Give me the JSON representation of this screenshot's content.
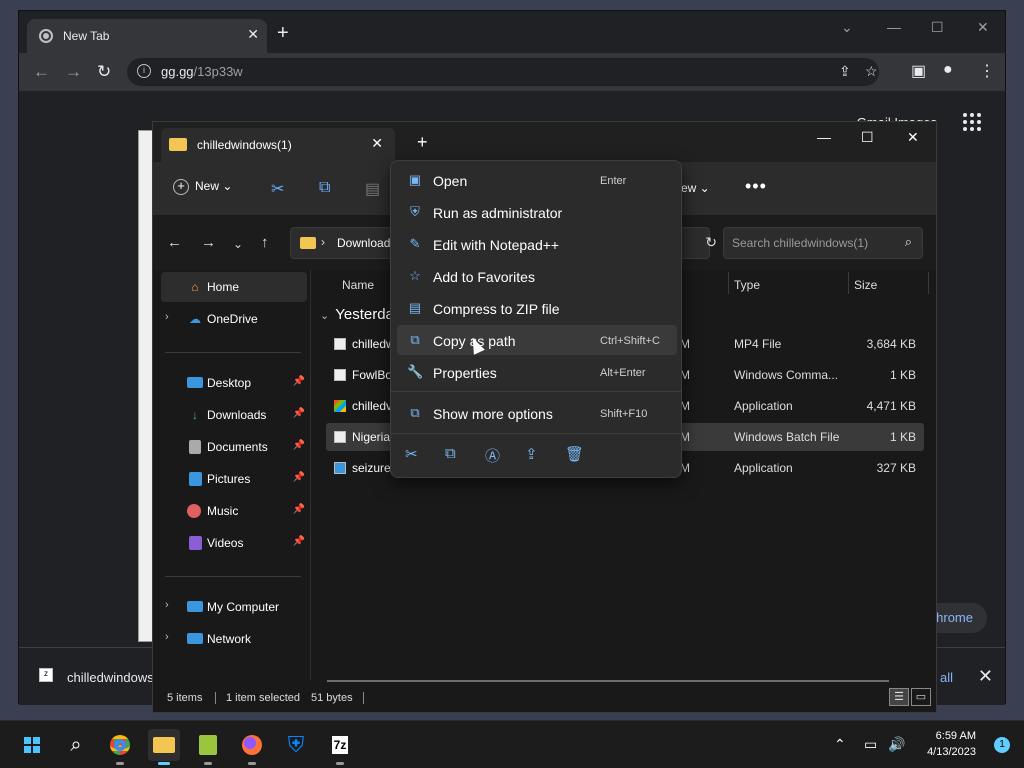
{
  "chrome": {
    "tab_title": "New Tab",
    "url_host": "gg.gg",
    "url_path": "/13p33w",
    "google_links": "Gmail   Images",
    "pill_text": "hrome",
    "download": {
      "file": "chilledwindows",
      "show_all": "all"
    }
  },
  "explorer": {
    "tab_title": "chilledwindows(1)",
    "toolbar": {
      "new_label": "New",
      "view_label": "ew"
    },
    "address": {
      "path": "Download"
    },
    "search": {
      "placeholder": "Search chilledwindows(1)"
    },
    "sidebar": {
      "items": [
        {
          "label": "Home",
          "icon": "home-icon",
          "color": "#e8a23a"
        },
        {
          "label": "OneDrive",
          "icon": "cloud-icon",
          "color": "#3a96dd"
        },
        {
          "label": "Desktop",
          "icon": "desktop-icon",
          "color": "#3a96dd"
        },
        {
          "label": "Downloads",
          "icon": "download-icon",
          "color": "#3ab07a"
        },
        {
          "label": "Documents",
          "icon": "document-icon",
          "color": "#aaaaaa"
        },
        {
          "label": "Pictures",
          "icon": "picture-icon",
          "color": "#3a96dd"
        },
        {
          "label": "Music",
          "icon": "music-icon",
          "color": "#e06060"
        },
        {
          "label": "Videos",
          "icon": "video-icon",
          "color": "#8a5fd6"
        },
        {
          "label": "My Computer",
          "icon": "computer-icon",
          "color": "#3a96dd"
        },
        {
          "label": "Network",
          "icon": "network-icon",
          "color": "#3a96dd"
        }
      ]
    },
    "columns": {
      "name": "Name",
      "type": "Type",
      "size": "Size"
    },
    "group": "Yesterda",
    "files": [
      {
        "name": "chilledw",
        "modified": "M",
        "type": "MP4 File",
        "size": "3,684 KB"
      },
      {
        "name": "FowlBo",
        "modified": "M",
        "type": "Windows Comma...",
        "size": "1 KB"
      },
      {
        "name": "chilledv",
        "modified": "M",
        "type": "Application",
        "size": "4,471 KB"
      },
      {
        "name": "Nigeria",
        "modified": "M",
        "type": "Windows Batch File",
        "size": "1 KB"
      },
      {
        "name": "seizure",
        "modified": "M",
        "type": "Application",
        "size": "327 KB"
      }
    ],
    "status": {
      "items": "5 items",
      "selected": "1 item selected",
      "bytes": "51 bytes"
    }
  },
  "context_menu": {
    "items": [
      {
        "label": "Open",
        "shortcut": "Enter",
        "icon": "open-icon"
      },
      {
        "label": "Run as administrator",
        "shortcut": "",
        "icon": "shield-icon"
      },
      {
        "label": "Edit with Notepad++",
        "shortcut": "",
        "icon": "notepadpp-icon"
      },
      {
        "label": "Add to Favorites",
        "shortcut": "",
        "icon": "star-icon"
      },
      {
        "label": "Compress to ZIP file",
        "shortcut": "",
        "icon": "zip-icon"
      },
      {
        "label": "Copy as path",
        "shortcut": "Ctrl+Shift+C",
        "icon": "copy-path-icon"
      },
      {
        "label": "Properties",
        "shortcut": "Alt+Enter",
        "icon": "wrench-icon"
      },
      {
        "label": "Show more options",
        "shortcut": "Shift+F10",
        "icon": "more-options-icon"
      }
    ]
  },
  "taskbar": {
    "time": "6:59 AM",
    "date": "4/13/2023",
    "notification_count": "1"
  }
}
